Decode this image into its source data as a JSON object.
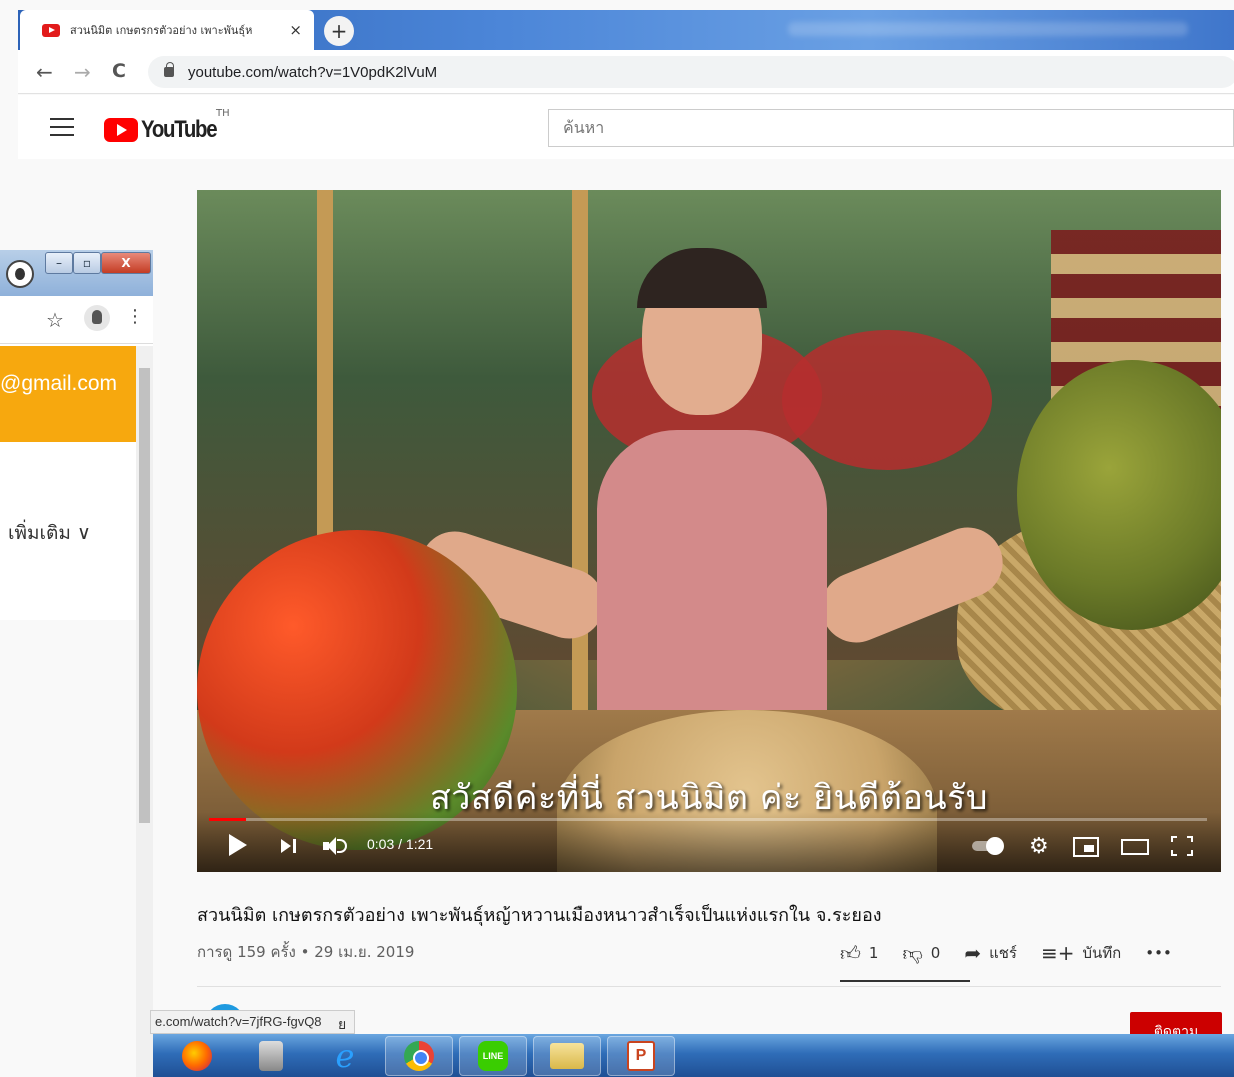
{
  "browser": {
    "tab_title": "สวนนิมิต เกษตรกรตัวอย่าง เพาะพันธุ์ห",
    "tab_close": "×",
    "new_tab": "+",
    "url": "youtube.com/watch?v=1V0pdK2lVuM",
    "nav": {
      "back": "←",
      "forward": "→",
      "reload": "C"
    }
  },
  "youtube": {
    "logo_text": "YouTube",
    "country": "TH",
    "search_placeholder": "ค้นหา"
  },
  "player": {
    "subtitle": "สวัสดีค่ะที่นี่ สวนนิมิต ค่ะ ยินดีต้อนรับ",
    "time": "0:03 / 1:21",
    "progress": 0.037,
    "gear": "⚙"
  },
  "video": {
    "title": "สวนนิมิต เกษตรกรตัวอย่าง เพาะพันธุ์หญ้าหวานเมืองหนาวสำเร็จเป็นแห่งแรกใน จ.ระยอง",
    "meta": "การดู 159 ครั้ง • 29 เม.ย. 2019",
    "likes": "1",
    "dislikes": "0",
    "share": "แชร์",
    "save": "บันทึก",
    "more": "•••",
    "subscribe": "ติดตาม"
  },
  "left_window": {
    "email": "@gmail.com",
    "more": "เพิ่มเติม ∨",
    "star": "☆",
    "menu": "⋮",
    "win_min": "–",
    "win_max": "▫",
    "win_close": "X"
  },
  "statusbar": {
    "url": "e.com/watch?v=7jfRG-fgvQ8",
    "tail": "ย"
  },
  "taskbar": {
    "items": [
      "firefox-icon",
      "calculator-icon",
      "internet-explorer-icon",
      "chrome-icon",
      "line-icon",
      "file-explorer-icon",
      "powerpoint-icon"
    ],
    "line_label": "LINE",
    "ie_glyph": "e",
    "ppt_glyph": "P"
  }
}
